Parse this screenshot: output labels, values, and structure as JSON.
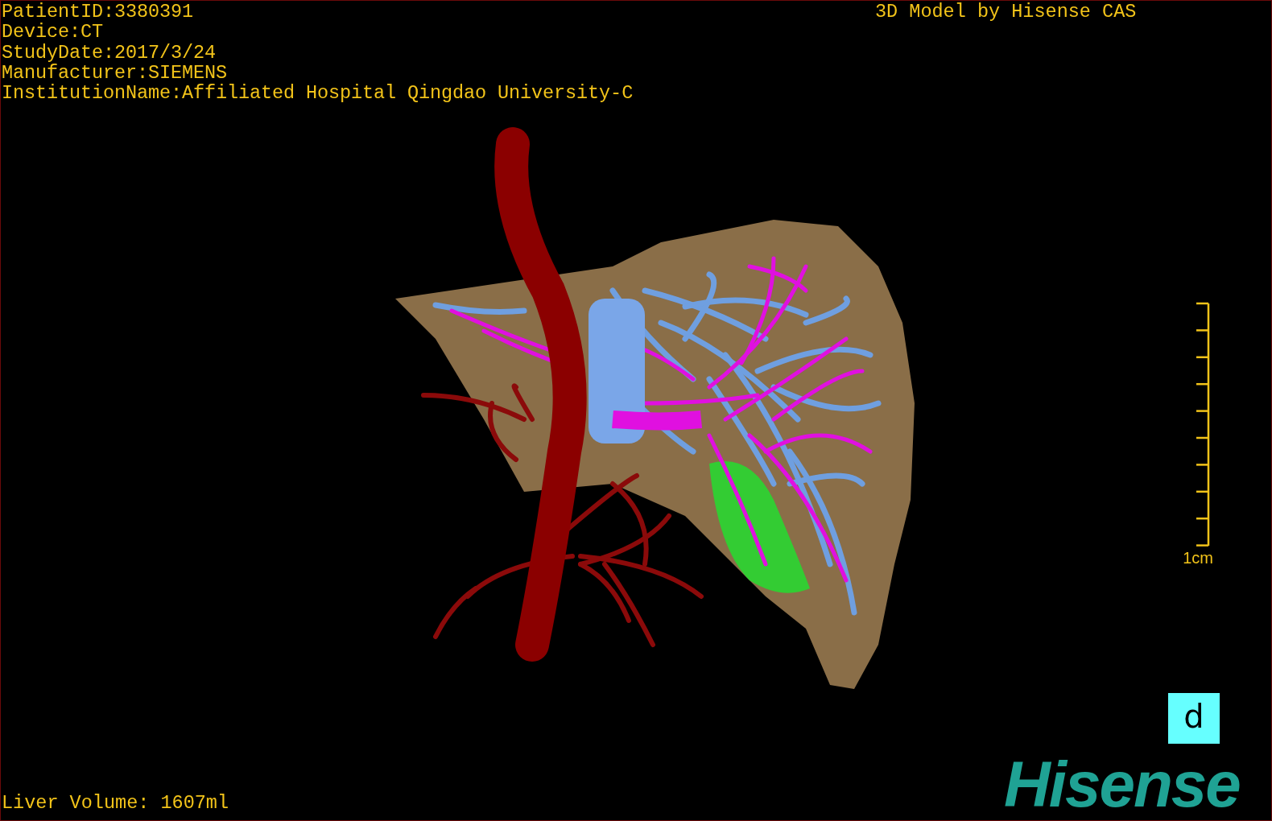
{
  "patient_info": [
    "PatientID:3380391",
    "Device:CT",
    "StudyDate:2017/3/24",
    "Manufacturer:SIEMENS",
    "InstitutionName:Affiliated Hospital Qingdao University-C"
  ],
  "model_credit": "3D Model by Hisense CAS",
  "scale_bar": {
    "label": "1cm"
  },
  "view_label": "d",
  "liver_volume": "Liver Volume: 1607ml",
  "logo": "Hisense"
}
